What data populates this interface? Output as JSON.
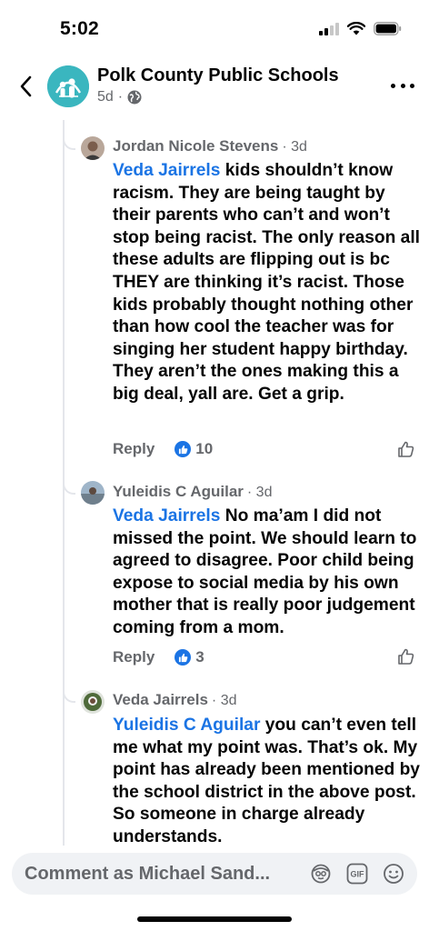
{
  "status_bar": {
    "time": "5:02"
  },
  "header": {
    "page_name": "Polk County Public Schools",
    "post_age": "5d",
    "brand_color": "#3ab6bf"
  },
  "comments": [
    {
      "author": "Jordan Nicole Stevens",
      "time": "· 3d",
      "mention": "Veda Jairrels",
      "text": " kids shouldn’t know racism. They are being taught by their parents who can’t and won’t stop being racist. The only reason all these adults are flipping out is bc THEY are thinking it’s racist. Those kids probably thought nothing other than how cool the teacher was for singing her student happy birthday. They aren’t the ones making this a big deal, yall are. Get a grip.",
      "reply_label": "Reply",
      "like_count": "10"
    },
    {
      "author": "Yuleidis C Aguilar",
      "time": "· 3d",
      "mention": "Veda Jairrels",
      "text": " No ma’am I did not missed the point. We should learn to agreed to disagree. Poor child being expose to social media by his own mother that is really poor judgement coming from a mom.",
      "reply_label": "Reply",
      "like_count": "3"
    },
    {
      "author": "Veda Jairrels",
      "time": "· 3d",
      "mention": "Yuleidis C Aguilar",
      "text": " you can’t even tell me what my point was. That’s ok. My point has already been mentioned by the school district in the above post. So someone in charge already understands."
    }
  ],
  "composer": {
    "placeholder": "Comment as Michael Sand...",
    "gif_label": "GIF"
  },
  "colors": {
    "mention": "#1b74e4",
    "secondary_text": "#65676b",
    "composer_bg": "#f0f2f5"
  }
}
